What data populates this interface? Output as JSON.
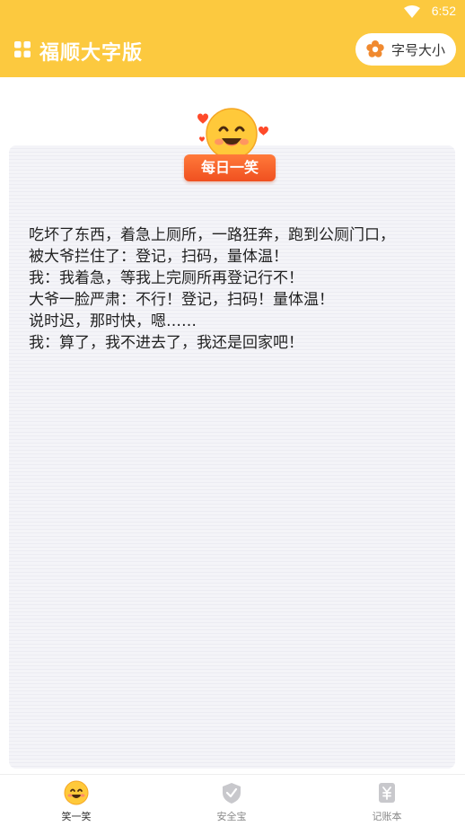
{
  "status_bar": {
    "time": "6:52"
  },
  "app_bar": {
    "title": "福顺大字版",
    "font_size_button": "字号大小"
  },
  "joke": {
    "badge_label": "每日一笑",
    "lines": [
      "吃坏了东西，着急上厕所，一路狂奔，跑到公厕门口，",
      "被大爷拦住了：登记，扫码，量体温！",
      "我：我着急，等我上完厕所再登记行不！",
      "大爷一脸严肃：不行！登记，扫码！量体温！",
      "说时迟，那时快，嗯……",
      "我：算了，我不进去了，我还是回家吧！"
    ]
  },
  "bottom_nav": {
    "items": [
      {
        "label": "笑一笑",
        "icon": "smiley-icon",
        "active": true
      },
      {
        "label": "安全宝",
        "icon": "shield-icon",
        "active": false
      },
      {
        "label": "记账本",
        "icon": "ledger-icon",
        "active": false
      }
    ]
  },
  "colors": {
    "header_bg": "#fcc93f",
    "badge_bg": "#f05020",
    "card_bg": "#f5f5f9"
  }
}
